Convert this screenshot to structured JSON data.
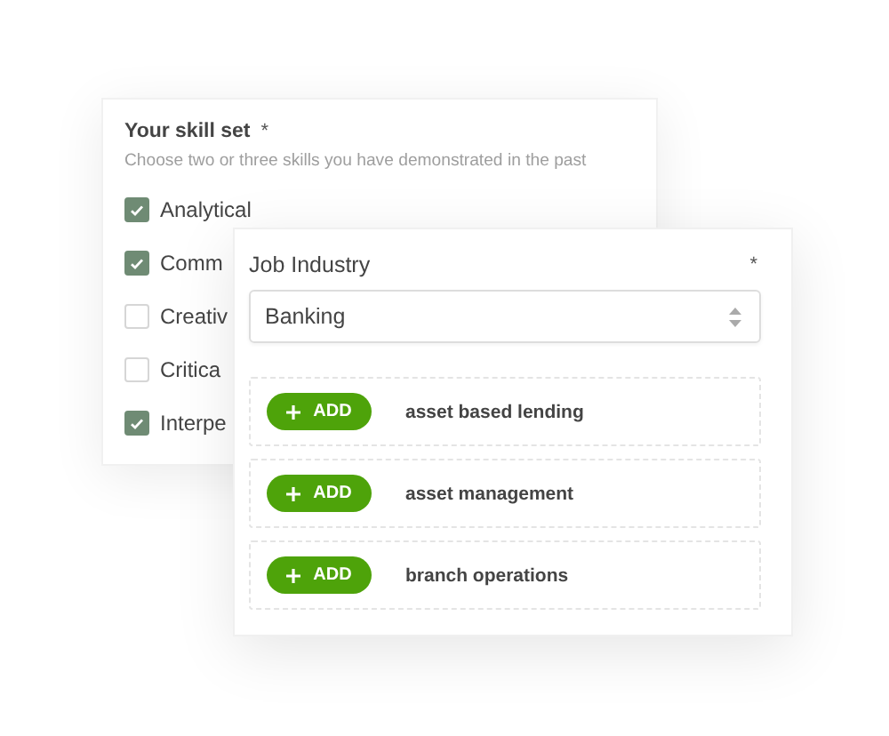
{
  "skill_set": {
    "title": "Your skill set",
    "required_mark": "*",
    "hint": "Choose two or three skills you have demonstrated in the past",
    "skills": [
      {
        "label": "Analytical",
        "checked": true
      },
      {
        "label": "Comm",
        "checked": true
      },
      {
        "label": "Creativ",
        "checked": false
      },
      {
        "label": "Critica",
        "checked": false
      },
      {
        "label": "Interpe",
        "checked": true
      }
    ]
  },
  "job_industry": {
    "title": "Job Industry",
    "required_mark": "*",
    "select": {
      "value": "Banking"
    },
    "options": [
      {
        "button": "ADD",
        "label": "asset based lending"
      },
      {
        "button": "ADD",
        "label": "asset management"
      },
      {
        "button": "ADD",
        "label": "branch operations"
      }
    ]
  }
}
